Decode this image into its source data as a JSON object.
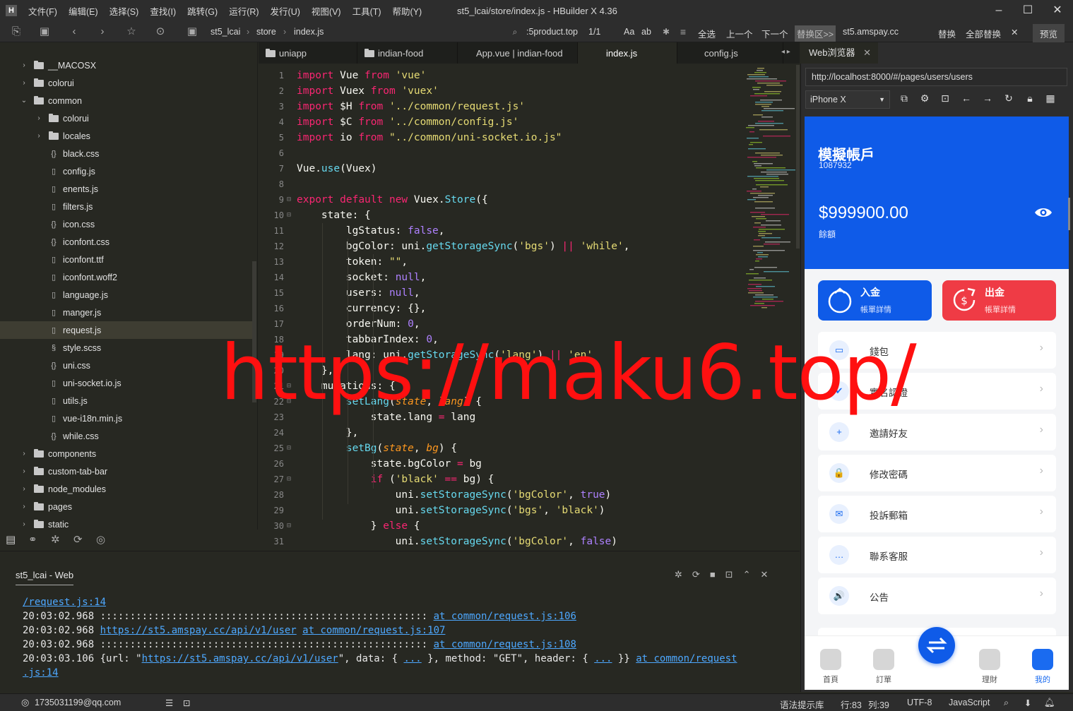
{
  "menubar": {
    "items": [
      "文件(F)",
      "编辑(E)",
      "选择(S)",
      "查找(I)",
      "跳转(G)",
      "运行(R)",
      "发行(U)",
      "视图(V)",
      "工具(T)",
      "帮助(Y)"
    ],
    "title": "st5_lcai/store/index.js - HBuilder X 4.36"
  },
  "toolbar": {
    "breadcrumb": [
      "st5_lcai",
      "store",
      "index.js"
    ],
    "search_value": ":5product.top",
    "match_count": "1/1",
    "aa": "Aa",
    "ab": "ab",
    "select_all": "全选",
    "prev": "上一个",
    "next": "下一个",
    "replace_area": "替换区>>",
    "replace_value": "st5.amspay.cc",
    "replace": "替换",
    "replace_all": "全部替换",
    "preview": "预览"
  },
  "sidebar": {
    "items": [
      {
        "label": "__MACOSX",
        "type": "folder",
        "depth": 1,
        "arrow": "›"
      },
      {
        "label": "colorui",
        "type": "folder",
        "depth": 1,
        "arrow": "›"
      },
      {
        "label": "common",
        "type": "folder",
        "depth": 1,
        "arrow": "⌄"
      },
      {
        "label": "colorui",
        "type": "folder",
        "depth": 2,
        "arrow": "›"
      },
      {
        "label": "locales",
        "type": "folder",
        "depth": 2,
        "arrow": "›"
      },
      {
        "label": "black.css",
        "type": "css",
        "depth": 2
      },
      {
        "label": "config.js",
        "type": "file",
        "depth": 2
      },
      {
        "label": "enents.js",
        "type": "file",
        "depth": 2
      },
      {
        "label": "filters.js",
        "type": "file",
        "depth": 2
      },
      {
        "label": "icon.css",
        "type": "css",
        "depth": 2
      },
      {
        "label": "iconfont.css",
        "type": "css",
        "depth": 2
      },
      {
        "label": "iconfont.ttf",
        "type": "file",
        "depth": 2
      },
      {
        "label": "iconfont.woff2",
        "type": "file",
        "depth": 2
      },
      {
        "label": "language.js",
        "type": "file",
        "depth": 2
      },
      {
        "label": "manger.js",
        "type": "file",
        "depth": 2
      },
      {
        "label": "request.js",
        "type": "file",
        "depth": 2,
        "selected": true
      },
      {
        "label": "style.scss",
        "type": "scss",
        "depth": 2
      },
      {
        "label": "uni.css",
        "type": "css",
        "depth": 2
      },
      {
        "label": "uni-socket.io.js",
        "type": "file",
        "depth": 2
      },
      {
        "label": "utils.js",
        "type": "file",
        "depth": 2
      },
      {
        "label": "vue-i18n.min.js",
        "type": "file",
        "depth": 2
      },
      {
        "label": "while.css",
        "type": "css",
        "depth": 2
      },
      {
        "label": "components",
        "type": "folder",
        "depth": 1,
        "arrow": "›"
      },
      {
        "label": "custom-tab-bar",
        "type": "folder",
        "depth": 1,
        "arrow": "›"
      },
      {
        "label": "node_modules",
        "type": "folder",
        "depth": 1,
        "arrow": "›"
      },
      {
        "label": "pages",
        "type": "folder",
        "depth": 1,
        "arrow": "›"
      },
      {
        "label": "static",
        "type": "folder",
        "depth": 1,
        "arrow": "›"
      }
    ]
  },
  "editor": {
    "tabs": [
      {
        "label": "uniapp",
        "folder": true
      },
      {
        "label": "indian-food",
        "folder": true
      },
      {
        "label": "App.vue | indian-food"
      },
      {
        "label": "index.js",
        "active": true
      },
      {
        "label": "config.js"
      }
    ]
  },
  "console": {
    "title": "st5_lcai - Web",
    "lines": [
      [
        {
          "t": "/request.js:14",
          "l": true
        }
      ],
      [
        {
          "t": "20:03:02.968 ::::::::::::::::::::::::::::::::::::::::::::::::::::::: "
        },
        {
          "t": "at common/request.js:106",
          "l": true
        }
      ],
      [
        {
          "t": "20:03:02.968 "
        },
        {
          "t": "https://st5.amspay.cc/api/v1/user",
          "l": true
        },
        {
          "t": " "
        },
        {
          "t": "at common/request.js:107",
          "l": true
        }
      ],
      [
        {
          "t": "20:03:02.968 ::::::::::::::::::::::::::::::::::::::::::::::::::::::: "
        },
        {
          "t": "at common/request.js:108",
          "l": true
        }
      ],
      [
        {
          "t": "20:03:03.106 {url: \""
        },
        {
          "t": "https://st5.amspay.cc/api/v1/user",
          "l": true
        },
        {
          "t": "\", data: { "
        },
        {
          "t": "...",
          "l": true
        },
        {
          "t": " }, method: \"GET\", header: { "
        },
        {
          "t": "...",
          "l": true
        },
        {
          "t": " }} "
        },
        {
          "t": "at common/request",
          "l": true
        }
      ],
      [
        {
          "t": ".js:14",
          "l": true
        }
      ]
    ]
  },
  "browser": {
    "tab_label": "Web浏览器",
    "url": "http://localhost:8000/#/pages/users/users",
    "device": "iPhone X",
    "app": {
      "account_title": "模擬帳戶",
      "account_id": "1087932",
      "balance": "$999900.00",
      "balance_label": "餘額",
      "deposit_title": "入金",
      "deposit_sub": "帳單詳情",
      "withdraw_title": "出金",
      "withdraw_sub": "帳單詳情",
      "menu": [
        {
          "label": "錢包",
          "icon": "wallet-icon",
          "glyph": "▭"
        },
        {
          "label": "實名認證",
          "icon": "verify-user-icon",
          "glyph": "✔"
        },
        {
          "label": "邀請好友",
          "icon": "invite-user-icon",
          "glyph": "+"
        },
        {
          "label": "修改密碼",
          "icon": "lock-icon",
          "glyph": "🔒"
        },
        {
          "label": "投訴郵箱",
          "icon": "mail-icon",
          "glyph": "✉"
        },
        {
          "label": "聯系客服",
          "icon": "chat-icon",
          "glyph": "…"
        },
        {
          "label": "公告",
          "icon": "speaker-icon",
          "glyph": "🔊"
        }
      ],
      "tabs": [
        "首頁",
        "訂單",
        "理財",
        "我的"
      ]
    }
  },
  "statusbar": {
    "user": "1735031199@qq.com",
    "hint": "语法提示库",
    "line": "行:83",
    "col": "列:39",
    "encoding": "UTF-8",
    "language": "JavaScript"
  },
  "watermark": "https://maku6.top/",
  "colors": {
    "accent": "#0f5be8",
    "danger": "#ef3b45",
    "keyword": "#f92672",
    "string": "#e6db74"
  }
}
